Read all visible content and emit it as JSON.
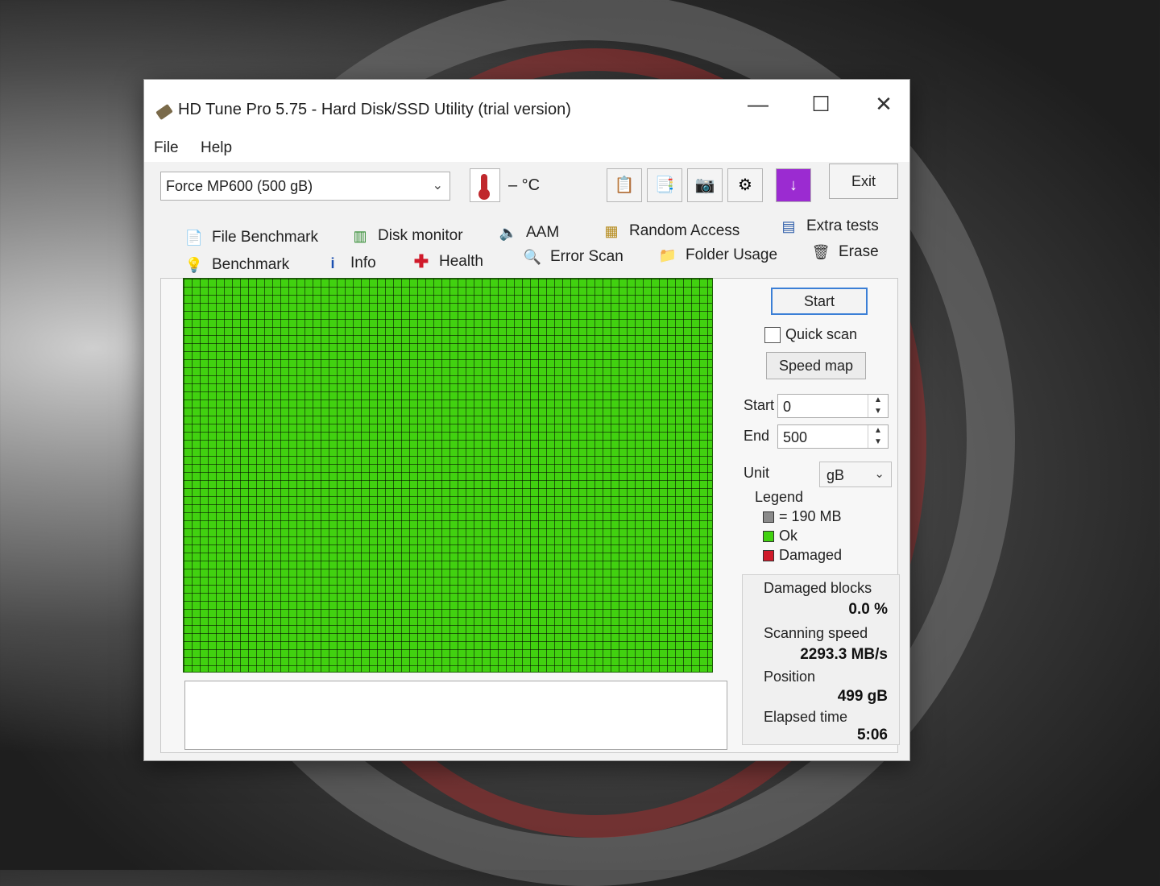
{
  "window": {
    "title": "HD Tune Pro 5.75 - Hard Disk/SSD Utility (trial version)",
    "minimize": "—",
    "maximize": "☐",
    "close": "✕"
  },
  "menu": {
    "file": "File",
    "help": "Help"
  },
  "toolbar": {
    "drive": "Force MP600 (500 gB)",
    "temperature": "– °C",
    "exit_label": "Exit",
    "icons": [
      "copy-text-icon",
      "copy-screenshot-icon",
      "camera-icon",
      "options-icon",
      "download-icon"
    ]
  },
  "tabs": {
    "row1": [
      "File Benchmark",
      "Disk monitor",
      "AAM",
      "Random Access",
      "Extra tests"
    ],
    "row2": [
      "Benchmark",
      "Info",
      "Health",
      "Error Scan",
      "Folder Usage",
      "Erase"
    ],
    "active": "Error Scan"
  },
  "scan": {
    "start_label": "Start",
    "quick_scan_label": "Quick scan",
    "quick_scan_checked": false,
    "speed_map_label": "Speed map",
    "start_field_label": "Start",
    "start_value": "0",
    "end_field_label": "End",
    "end_value": "500",
    "unit_label": "Unit",
    "unit_value": "gB"
  },
  "legend": {
    "title": "Legend",
    "block": "= 190 MB",
    "ok": "Ok",
    "damaged": "Damaged",
    "colors": {
      "block": "#8a8a8a",
      "ok": "#41d110",
      "damaged": "#d01a2a"
    }
  },
  "stats": {
    "damaged_label": "Damaged blocks",
    "damaged_value": "0.0 %",
    "speed_label": "Scanning speed",
    "speed_value": "2293.3 MB/s",
    "position_label": "Position",
    "position_value": "499 gB",
    "elapsed_label": "Elapsed time",
    "elapsed_value": "5:06"
  }
}
